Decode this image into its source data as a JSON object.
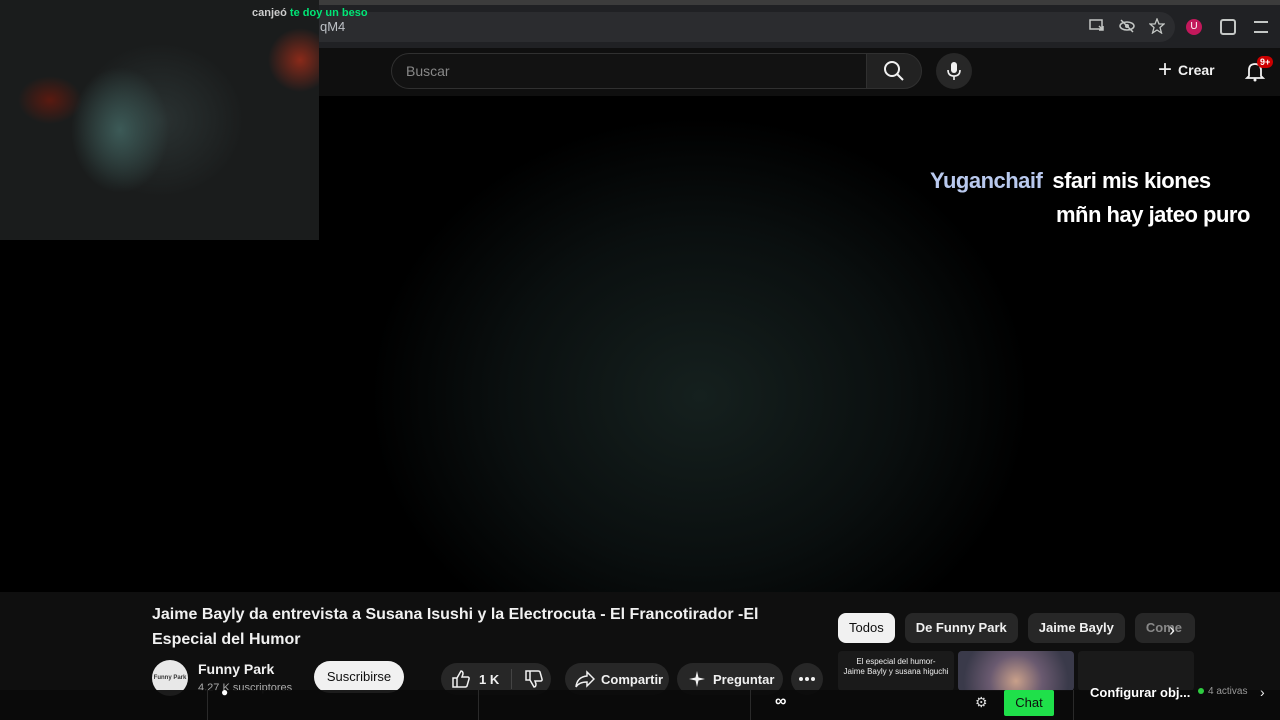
{
  "browser": {
    "url": "qM4",
    "icons": [
      "install-icon",
      "eye-off-icon",
      "star-icon"
    ],
    "extensions": [
      "profile-icon",
      "puzzle-icon",
      "menu-icon"
    ]
  },
  "header": {
    "search_placeholder": "Buscar",
    "create_label": "Crear",
    "notifications_badge": "9+"
  },
  "video_overlay": {
    "chat_user": "Yuganchaif",
    "chat_line1": "sfari mis kiones",
    "chat_line2": "mñn hay jateo puro"
  },
  "video": {
    "title": "Jaime Bayly da entrevista a Susana Isushi y la Electrocuta - El Francotirador -El Especial del Humor",
    "channel_name": "Funny Park",
    "channel_avatar_text": "Funny Park",
    "subscribers": "4.27 K suscriptores",
    "subscribe_label": "Suscribirse",
    "likes": "1 K",
    "share_label": "Compartir",
    "ask_label": "Preguntar"
  },
  "chips": [
    "Todos",
    "De Funny Park",
    "Jaime Bayly",
    "Come"
  ],
  "thumbnails": {
    "first_text_line1": "El especial del humor-",
    "first_text_line2": "Jaime Bayly y susana higuchi"
  },
  "stream_bar": {
    "redeem_prefix": "canjeó",
    "redeem_text": "te doy un beso",
    "chat_label": "Chat",
    "configure_label": "Configurar obj...",
    "active_label": "4 activas"
  },
  "colors": {
    "chat_user": "#b9c9ee",
    "chat_button": "#1fe04a",
    "badge": "#cc0000"
  }
}
